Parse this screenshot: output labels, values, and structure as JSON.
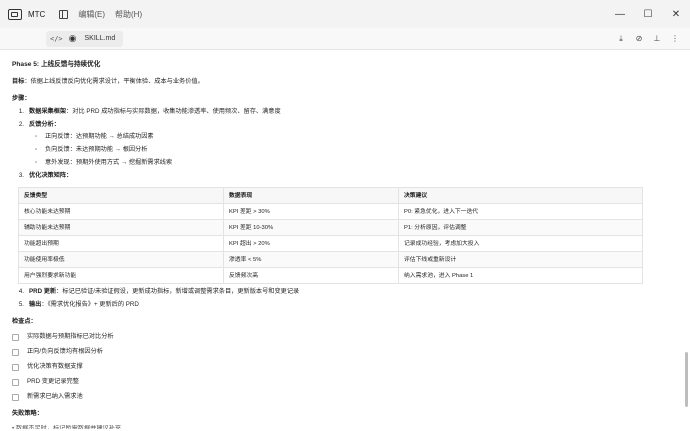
{
  "titlebar": {
    "app_name": "MTC",
    "menu": [
      "编辑(E)",
      "帮助(H)"
    ],
    "controls": {
      "minimize": "—",
      "maximize": "☐",
      "close": "✕"
    }
  },
  "filebar": {
    "code_icon": "</>",
    "eye_icon": "◉",
    "file_name": "SKILL.md",
    "tools": [
      "⤓",
      "⊘",
      "⊥",
      "⋮"
    ]
  },
  "doc": {
    "phase_title": "Phase 5: 上线反馈与持续优化",
    "goal_label": "目标",
    "goal_text": "：依据上线反馈反向优化需求设计，平衡体验、成本与业务价值。",
    "steps_label": "步骤：",
    "step1_num": "1.",
    "step1_label": "数据采集框架",
    "step1_text": "：对比 PRD 成功指标与实际数据，收集功能渗透率、使用频次、留存、满意度",
    "step2_num": "2.",
    "step2_label": "反馈分析：",
    "step2_items": [
      "正向反馈：达预期功能 → 总结成功因素",
      "负向反馈：未达预期功能 → 根因分析",
      "意外发现：预期外使用方式 → 挖掘新需求线索"
    ],
    "step3_num": "3.",
    "step3_label": "优化决策矩阵：",
    "table": {
      "headers": [
        "反馈类型",
        "数据表现",
        "决策建议"
      ],
      "rows": [
        [
          "核心功能未达预期",
          "KPI 差距 > 30%",
          "P0: 紧急优化，进入下一迭代"
        ],
        [
          "辅助功能未达预期",
          "KPI 差距 10-30%",
          "P1: 分析原因，评估调整"
        ],
        [
          "功能超出预期",
          "KPI 超出 > 20%",
          "记录成功经验，考虑加大投入"
        ],
        [
          "功能使用率极低",
          "渗透率 < 5%",
          "评估下线或重新设计"
        ],
        [
          "用户强烈要求新功能",
          "反馈频次高",
          "纳入需求池，进入 Phase 1"
        ]
      ]
    },
    "step4_num": "4.",
    "step4_label": "PRD 更新",
    "step4_text": "：标记已验证/未验证假设，更新成功指标，新增或调整需求条目，更新版本号和变更记录",
    "step5_num": "5.",
    "step5_label": "输出",
    "step5_text": "：《需求优化报告》+ 更新后的 PRD",
    "checkpoints_label": "检查点：",
    "checkpoints": [
      "实际数据与预期指标已对比分析",
      "正向/负向反馈均有根因分析",
      "优化决策有数据支撑",
      "PRD 变更记录完整",
      "新需求已纳入需求池"
    ],
    "failure_label": "失败策略：",
    "failure_cut": "• 数据不足时，标记所需数据并建议补充"
  }
}
